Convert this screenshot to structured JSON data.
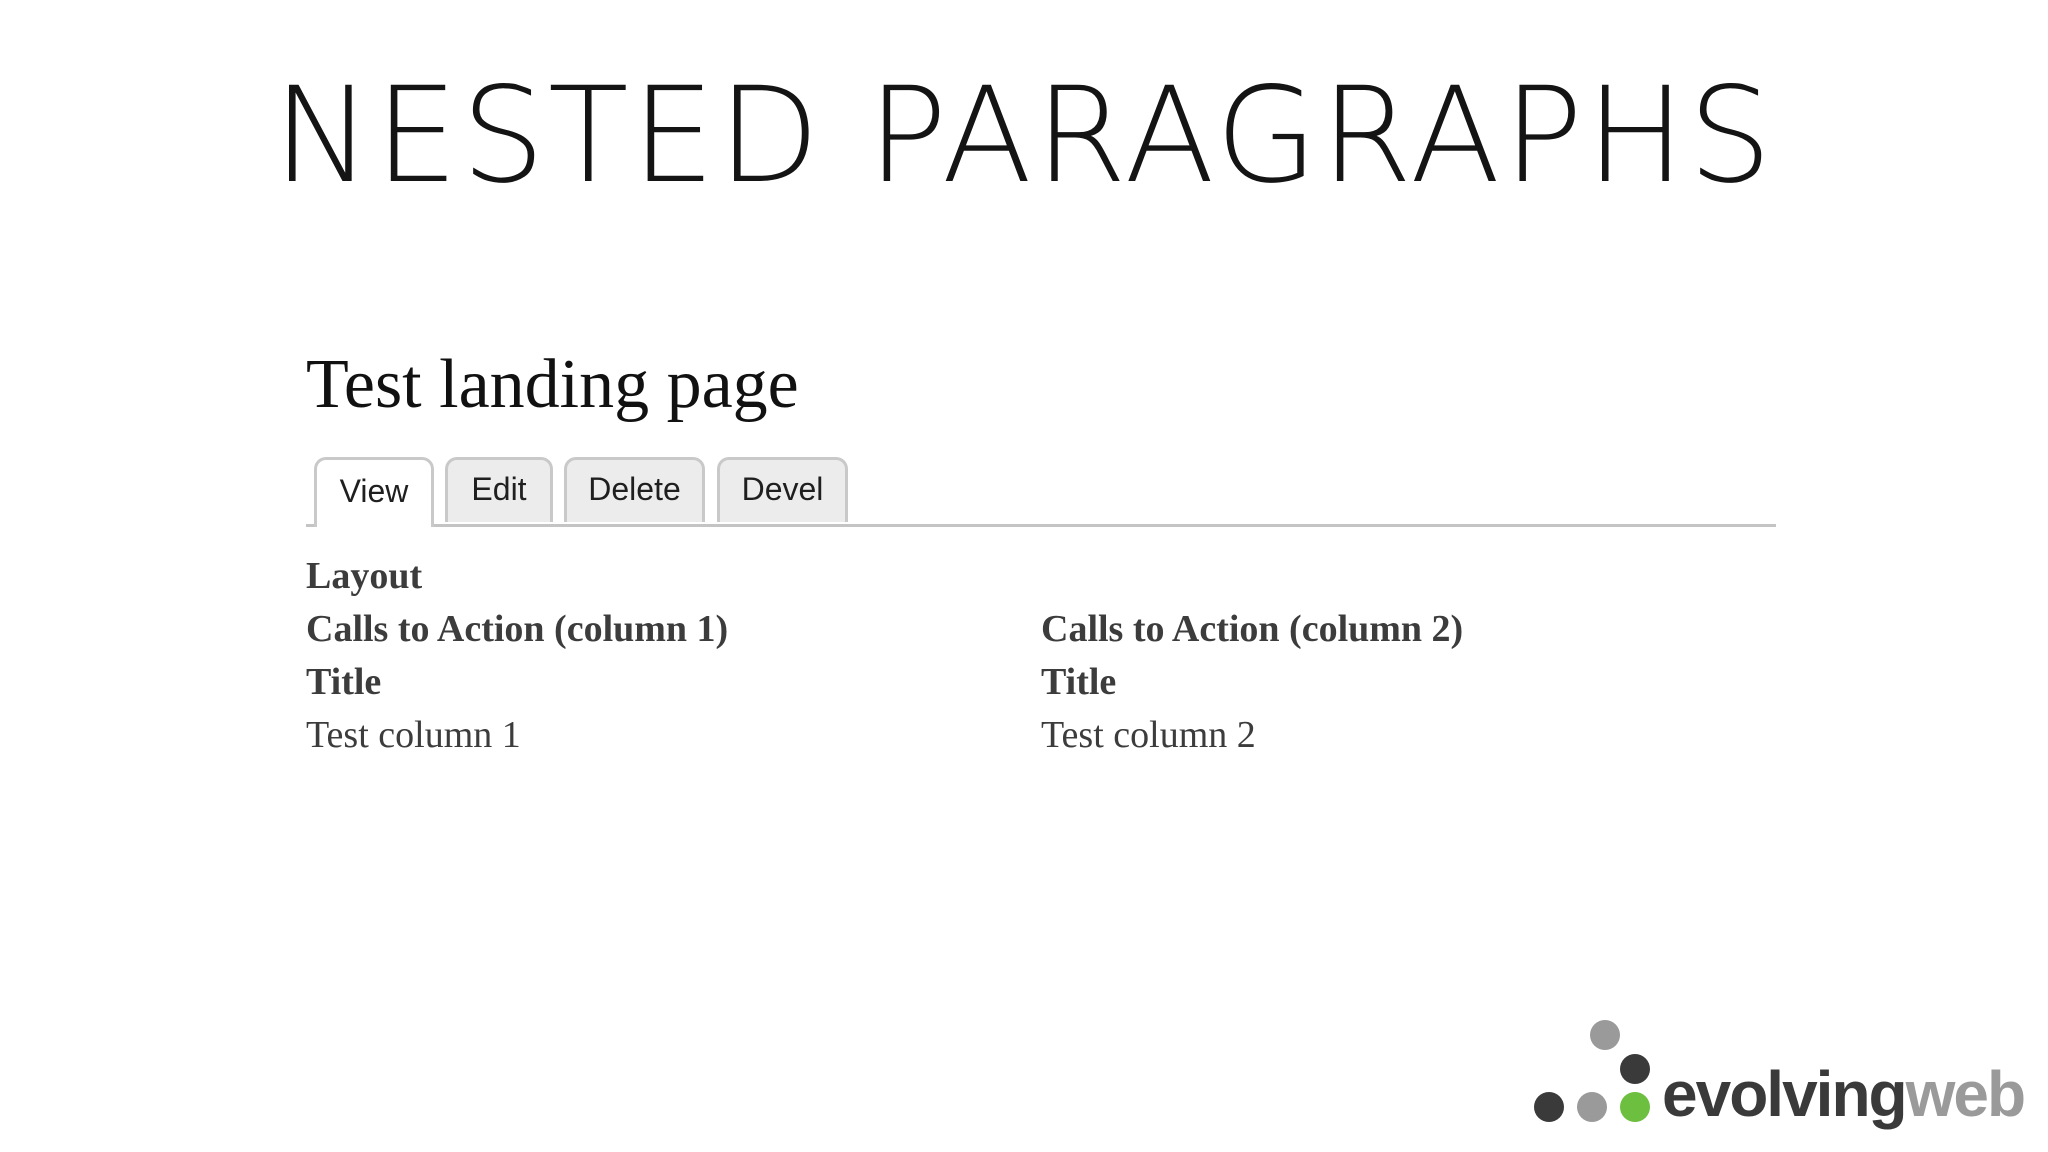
{
  "slide": {
    "title": "NESTED PARAGRAPHS"
  },
  "page": {
    "title": "Test landing page",
    "tabs": [
      {
        "label": "View",
        "active": true
      },
      {
        "label": "Edit",
        "active": false
      },
      {
        "label": "Delete",
        "active": false
      },
      {
        "label": "Devel",
        "active": false
      }
    ]
  },
  "content": {
    "layout_label": "Layout",
    "columns": [
      {
        "heading": "Calls to Action (column 1)",
        "field_label": "Title",
        "field_value": "Test column 1"
      },
      {
        "heading": "Calls to Action (column 2)",
        "field_label": "Title",
        "field_value": "Test column 2"
      }
    ]
  },
  "logo": {
    "text_dark": "evolving",
    "text_light": "web",
    "colors": {
      "dark": "#3a3a3a",
      "grey": "#9a9a9a",
      "green": "#6cbf3f"
    }
  }
}
